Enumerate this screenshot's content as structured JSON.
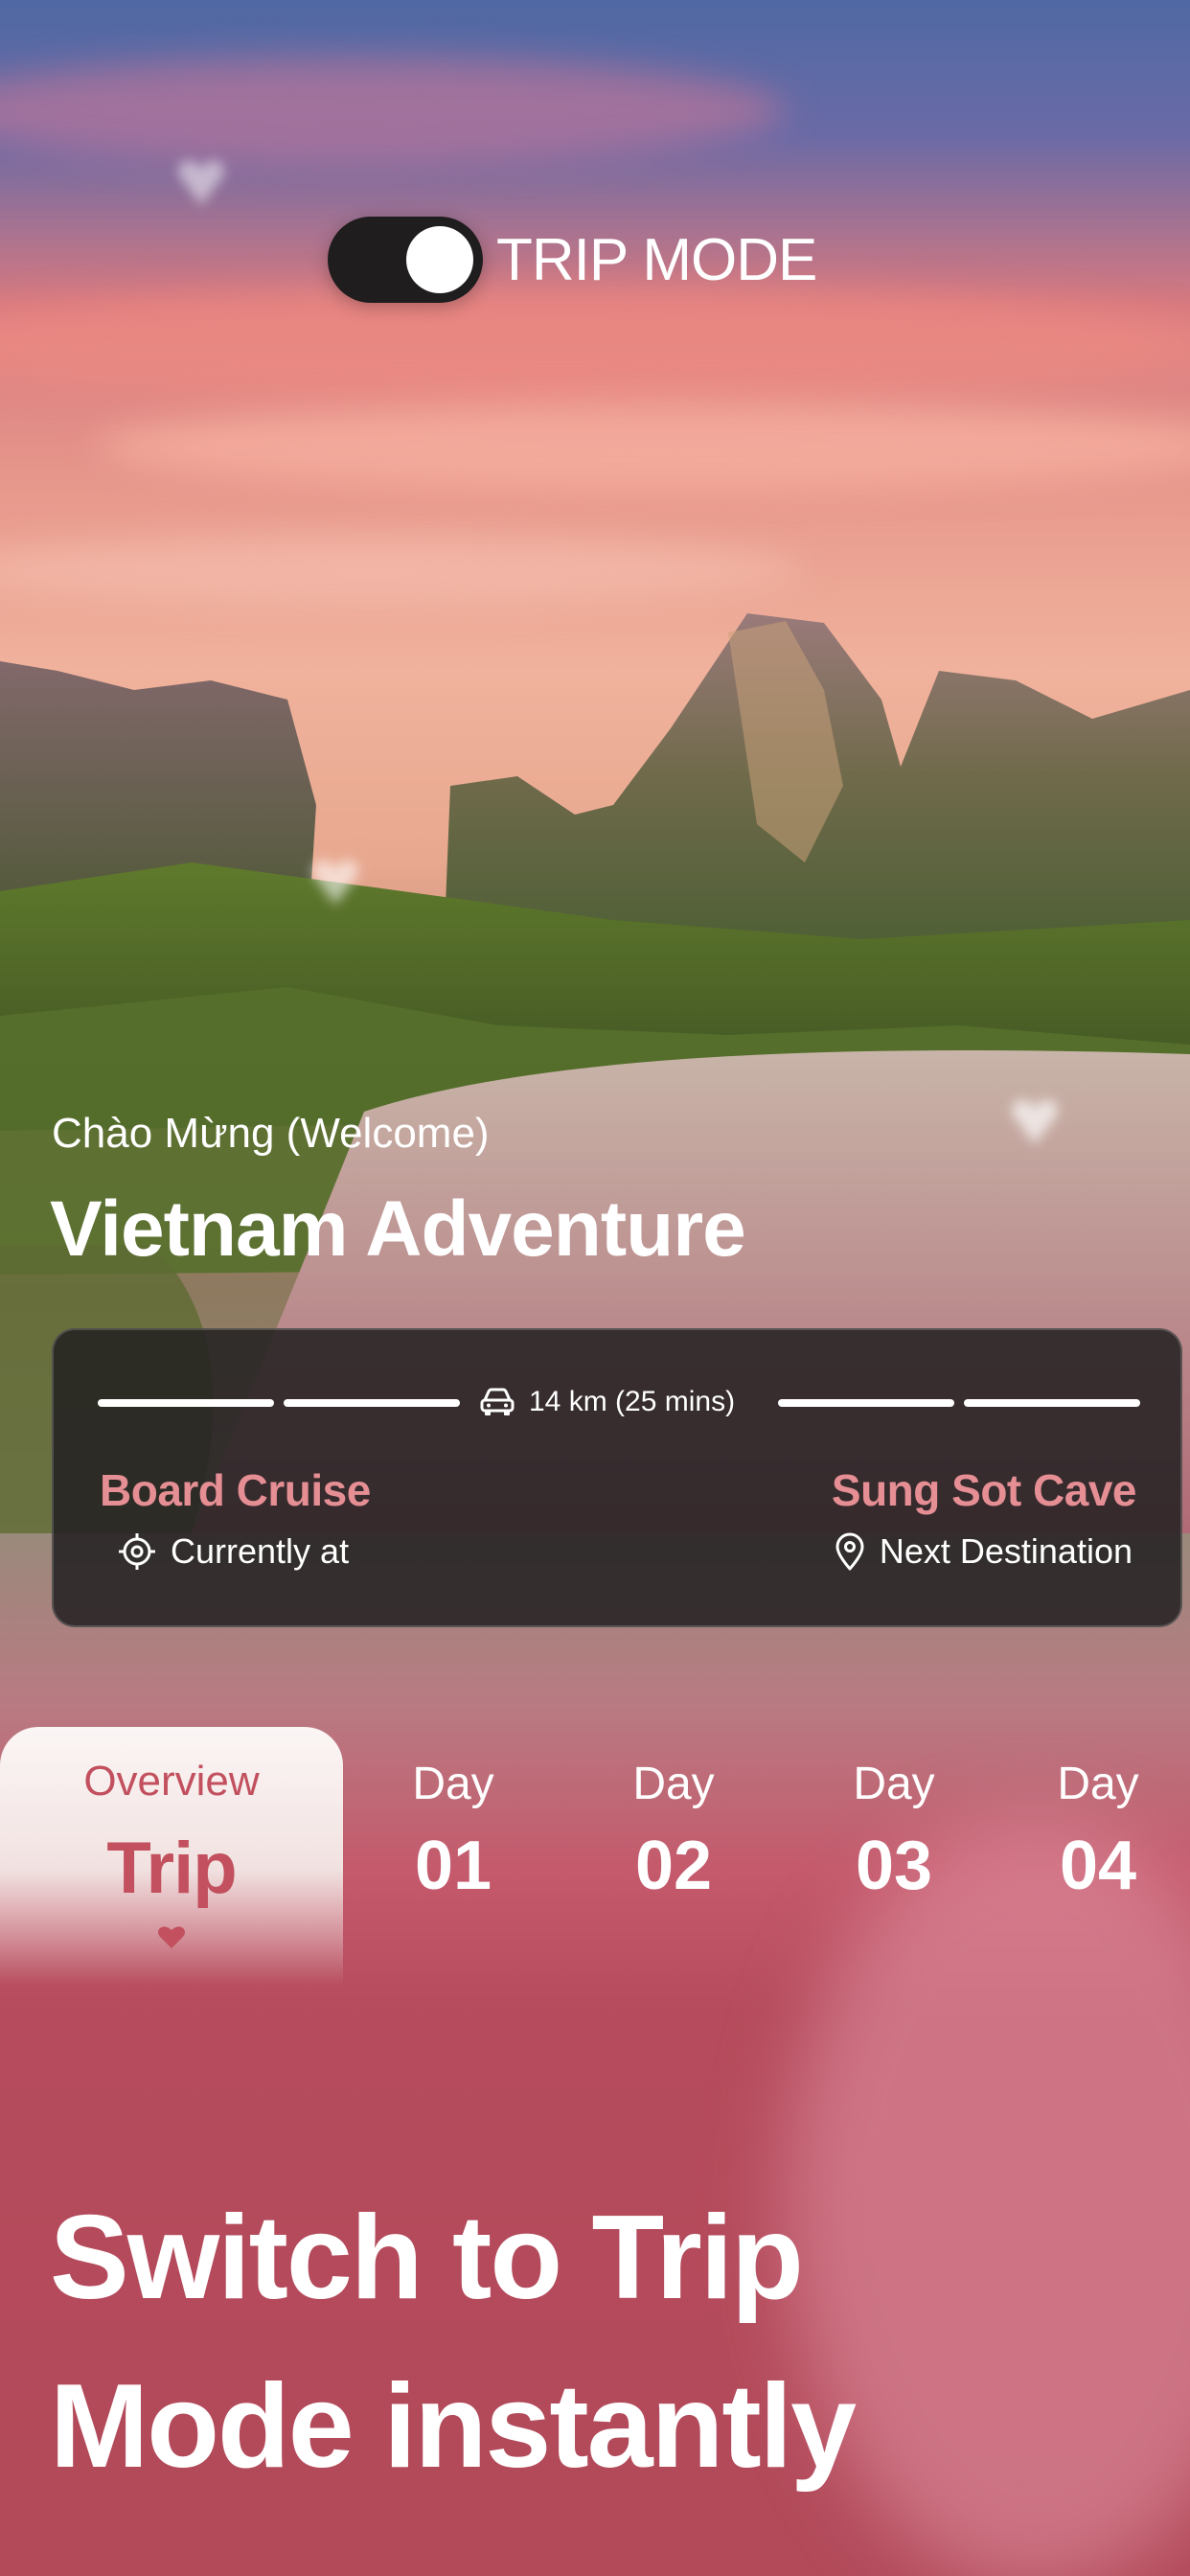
{
  "trip_mode": {
    "label": "TRIP MODE",
    "enabled": true
  },
  "welcome": {
    "subtitle": "Chào Mừng (Welcome)",
    "title": "Vietnam Adventure"
  },
  "route": {
    "distance": "14 km (25 mins)",
    "current": {
      "name": "Board Cruise",
      "status": "Currently at"
    },
    "next": {
      "name": "Sung Sot Cave",
      "status": "Next Destination"
    }
  },
  "tabs": {
    "active": {
      "top": "Overview",
      "main": "Trip"
    },
    "days": [
      {
        "top": "Day",
        "main": "01"
      },
      {
        "top": "Day",
        "main": "02"
      },
      {
        "top": "Day",
        "main": "03"
      },
      {
        "top": "Day",
        "main": "04"
      }
    ]
  },
  "headline": {
    "line1": "Switch to Trip",
    "line2": "Mode instantly"
  },
  "colors": {
    "accent": "#e58e94",
    "tab_accent": "#c2505e",
    "card_bg": "#222021",
    "bottom_bg": "#b24a5a"
  },
  "icons": {
    "distance": "car-icon",
    "current": "crosshair-icon",
    "next": "location-pin-icon",
    "active_tab": "heart-icon"
  }
}
